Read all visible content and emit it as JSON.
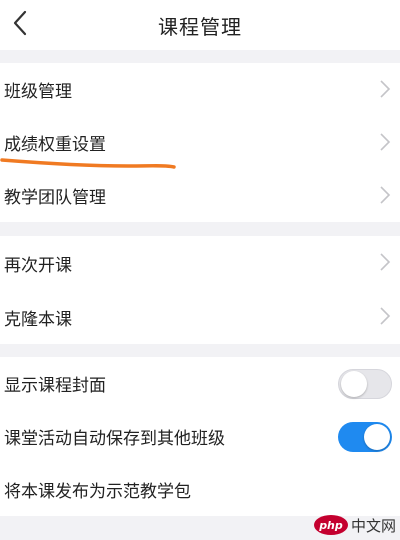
{
  "header": {
    "title": "课程管理",
    "back_icon": "chevron-left-icon"
  },
  "section1": {
    "items": [
      {
        "label": "班级管理"
      },
      {
        "label": "成绩权重设置"
      },
      {
        "label": "教学团队管理"
      }
    ]
  },
  "section2": {
    "items": [
      {
        "label": "再次开课"
      },
      {
        "label": "克隆本课"
      }
    ]
  },
  "section3": {
    "items": [
      {
        "label": "显示课程封面",
        "toggle": "off"
      },
      {
        "label": "课堂活动自动保存到其他班级",
        "toggle": "on"
      },
      {
        "label": "将本课发布为示范教学包"
      }
    ]
  },
  "watermark": {
    "logo": "php",
    "text": "中文网"
  },
  "colors": {
    "accent": "#1f8af0",
    "annotation": "#f07a22",
    "background": "#f2f2f5"
  }
}
